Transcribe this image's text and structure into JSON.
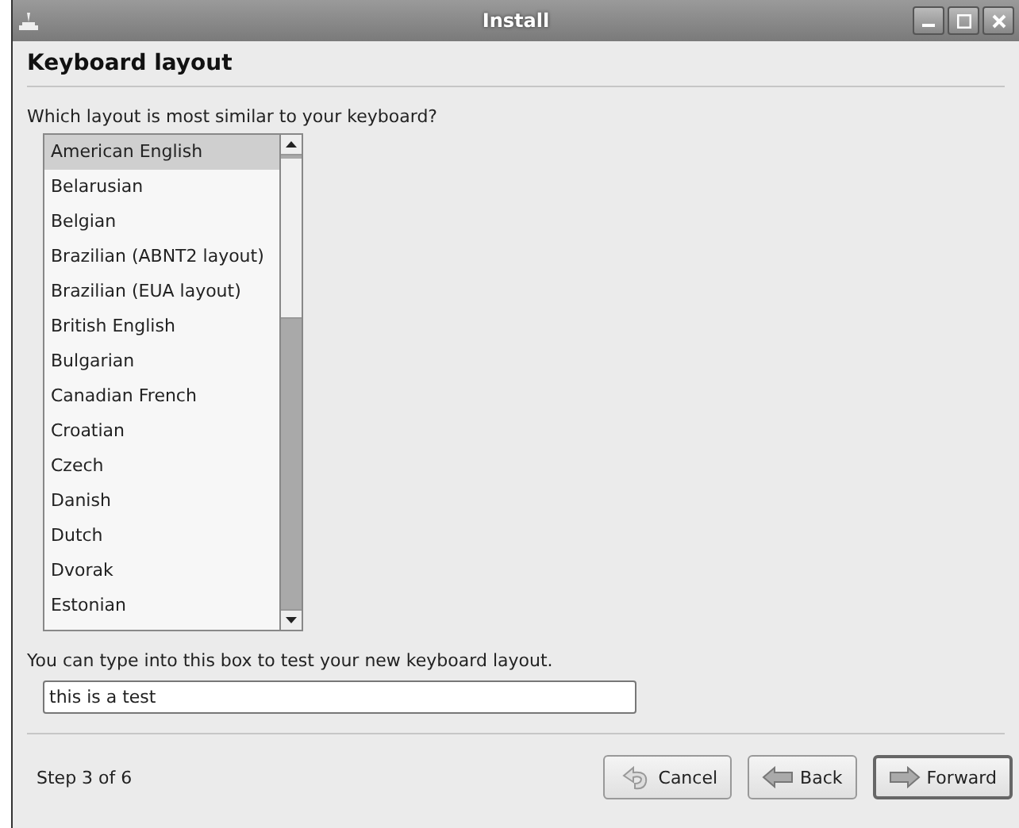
{
  "window": {
    "title": "Install"
  },
  "heading": "Keyboard layout",
  "question": "Which layout is most similar to your keyboard?",
  "layouts": [
    {
      "label": "American English",
      "selected": true
    },
    {
      "label": "Belarusian",
      "selected": false
    },
    {
      "label": "Belgian",
      "selected": false
    },
    {
      "label": "Brazilian (ABNT2 layout)",
      "selected": false
    },
    {
      "label": "Brazilian (EUA layout)",
      "selected": false
    },
    {
      "label": "British English",
      "selected": false
    },
    {
      "label": "Bulgarian",
      "selected": false
    },
    {
      "label": "Canadian French",
      "selected": false
    },
    {
      "label": "Croatian",
      "selected": false
    },
    {
      "label": "Czech",
      "selected": false
    },
    {
      "label": "Danish",
      "selected": false
    },
    {
      "label": "Dutch",
      "selected": false
    },
    {
      "label": "Dvorak",
      "selected": false
    },
    {
      "label": "Estonian",
      "selected": false
    }
  ],
  "test": {
    "label": "You can type into this box to test your new keyboard layout.",
    "value": "this is a test"
  },
  "step": "Step 3 of 6",
  "buttons": [
    {
      "kind": "cancel",
      "label": "Cancel",
      "default": false
    },
    {
      "kind": "back",
      "label": "Back",
      "default": false
    },
    {
      "kind": "forward",
      "label": "Forward",
      "default": true
    }
  ]
}
